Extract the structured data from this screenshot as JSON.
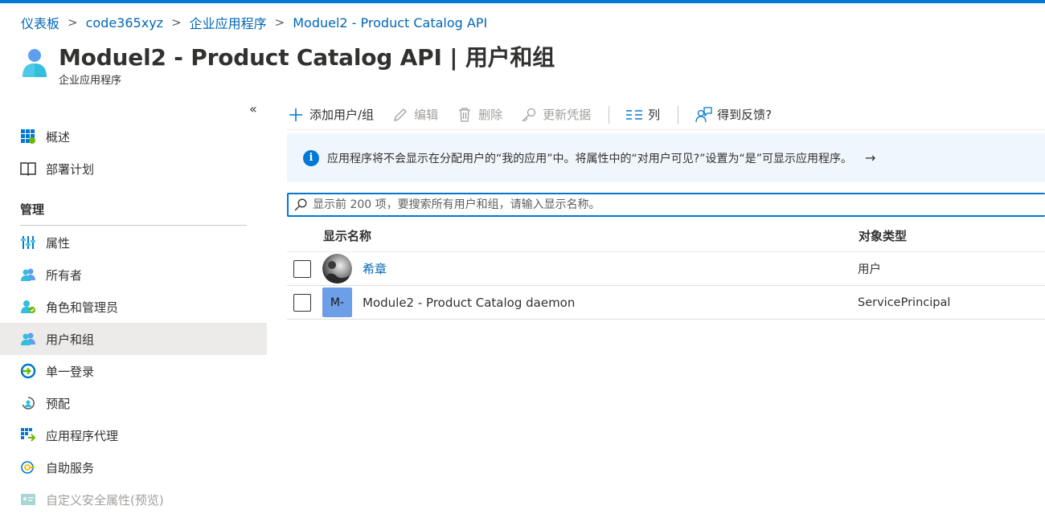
{
  "breadcrumb": [
    "仪表板",
    "code365xyz",
    "企业应用程序",
    "Moduel2 - Product Catalog API"
  ],
  "header": {
    "title": "Moduel2 - Product Catalog API | 用户和组",
    "subtitle": "企业应用程序",
    "more": "···"
  },
  "sidebar": {
    "collapse": "«",
    "top_items": [
      {
        "label": "概述",
        "icon": "grid-icon"
      },
      {
        "label": "部署计划",
        "icon": "book-icon"
      }
    ],
    "section_title": "管理",
    "items": [
      {
        "label": "属性",
        "icon": "properties-icon"
      },
      {
        "label": "所有者",
        "icon": "owners-icon"
      },
      {
        "label": "角色和管理员",
        "icon": "roles-icon"
      },
      {
        "label": "用户和组",
        "icon": "users-groups-icon",
        "active": true
      },
      {
        "label": "单一登录",
        "icon": "sso-icon"
      },
      {
        "label": "预配",
        "icon": "provisioning-icon"
      },
      {
        "label": "应用程序代理",
        "icon": "app-proxy-icon"
      },
      {
        "label": "自助服务",
        "icon": "self-service-icon"
      },
      {
        "label": "自定义安全属性(预览)",
        "icon": "custom-attr-icon",
        "disabled": true
      }
    ]
  },
  "toolbar": {
    "add": "添加用户/组",
    "edit": "编辑",
    "delete": "删除",
    "update_credentials": "更新凭据",
    "columns": "列",
    "feedback": "得到反馈?"
  },
  "info": {
    "text": "应用程序将不会显示在分配用户的“我的应用”中。将属性中的“对用户可见?”设置为“是”可显示应用程序。",
    "arrow": "→"
  },
  "search": {
    "placeholder": "显示前 200 项，要搜索所有用户和组，请输入显示名称。"
  },
  "table": {
    "headers": {
      "name": "显示名称",
      "type": "对象类型"
    },
    "rows": [
      {
        "name": "希章",
        "type": "用户",
        "avatar": "photo"
      },
      {
        "name": "Module2 - Product Catalog daemon",
        "type": "ServicePrincipal",
        "avatar": "M-"
      }
    ]
  },
  "colors": {
    "accent": "#0078d4",
    "link": "#0067b8",
    "info_bg": "#eff6fc",
    "active_nav": "#edebe9"
  }
}
